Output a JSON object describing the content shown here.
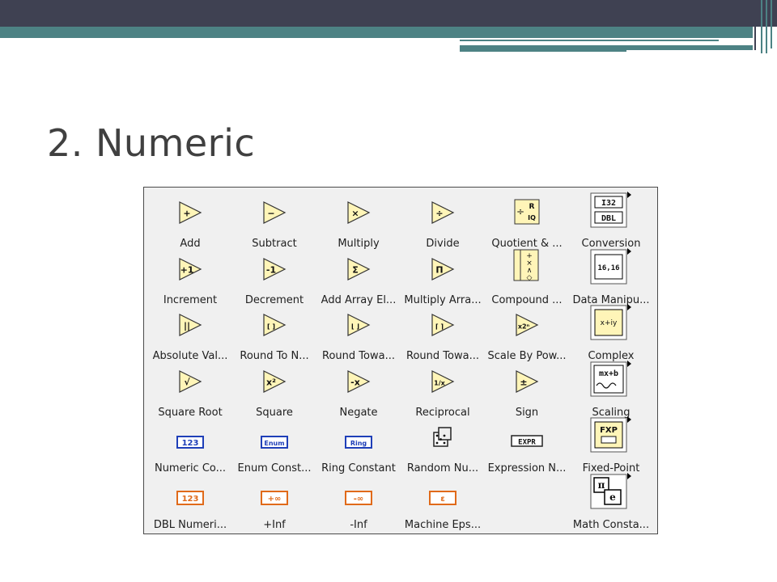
{
  "slide": {
    "title": "2. Numeric"
  },
  "palette": {
    "items": [
      {
        "label": "Add",
        "glyph": "+",
        "kind": "tri"
      },
      {
        "label": "Subtract",
        "glyph": "−",
        "kind": "tri"
      },
      {
        "label": "Multiply",
        "glyph": "×",
        "kind": "tri"
      },
      {
        "label": "Divide",
        "glyph": "÷",
        "kind": "tri"
      },
      {
        "label": "Quotient & ...",
        "glyph": "÷",
        "kind": "quotient"
      },
      {
        "label": "Conversion",
        "glyph": "I32 DBL",
        "kind": "conversion"
      },
      {
        "label": "Increment",
        "glyph": "+1",
        "kind": "tri"
      },
      {
        "label": "Decrement",
        "glyph": "-1",
        "kind": "tri"
      },
      {
        "label": "Add Array El...",
        "glyph": "Σ",
        "kind": "tri"
      },
      {
        "label": "Multiply Arra...",
        "glyph": "Π",
        "kind": "tri"
      },
      {
        "label": "Compound ...",
        "glyph": "+×",
        "kind": "compound"
      },
      {
        "label": "Data Manipu...",
        "glyph": "16 16",
        "kind": "datamanip"
      },
      {
        "label": "Absolute Val...",
        "glyph": "||",
        "kind": "tri"
      },
      {
        "label": "Round To N...",
        "glyph": "[ ]",
        "kind": "tri"
      },
      {
        "label": "Round Towa...",
        "glyph": "⌊ ⌋",
        "kind": "tri"
      },
      {
        "label": "Round Towa...",
        "glyph": "⌈ ⌉",
        "kind": "tri"
      },
      {
        "label": "Scale By Pow...",
        "glyph": "x2ⁿ",
        "kind": "tri"
      },
      {
        "label": "Complex",
        "glyph": "x+iy",
        "kind": "complex"
      },
      {
        "label": "Square Root",
        "glyph": "√",
        "kind": "tri"
      },
      {
        "label": "Square",
        "glyph": "x²",
        "kind": "tri"
      },
      {
        "label": "Negate",
        "glyph": "-x",
        "kind": "tri"
      },
      {
        "label": "Reciprocal",
        "glyph": "1/x",
        "kind": "tri"
      },
      {
        "label": "Sign",
        "glyph": "±",
        "kind": "tri"
      },
      {
        "label": "Scaling",
        "glyph": "mx+b",
        "kind": "scaling"
      },
      {
        "label": "Numeric Co...",
        "glyph": "123",
        "kind": "blueconst"
      },
      {
        "label": "Enum Const...",
        "glyph": "Enum",
        "kind": "blueconst"
      },
      {
        "label": "Ring Constant",
        "glyph": "Ring",
        "kind": "blueconst"
      },
      {
        "label": "Random Nu...",
        "glyph": "dice",
        "kind": "dice"
      },
      {
        "label": "Expression N...",
        "glyph": "EXPR",
        "kind": "expr"
      },
      {
        "label": "Fixed-Point",
        "glyph": "FXP",
        "kind": "fxp"
      },
      {
        "label": "DBL Numeri...",
        "glyph": "123",
        "kind": "orangeconst"
      },
      {
        "label": "+Inf",
        "glyph": "+∞",
        "kind": "orangeconst"
      },
      {
        "label": "-Inf",
        "glyph": "-∞",
        "kind": "orangeconst"
      },
      {
        "label": "Machine Eps...",
        "glyph": "ε",
        "kind": "orangeconst"
      },
      {
        "label": "",
        "glyph": "",
        "kind": "empty"
      },
      {
        "label": "Math Consta...",
        "glyph": "π e",
        "kind": "mathconst"
      }
    ]
  },
  "colors": {
    "topbar": "#3f4152",
    "accent": "#4d8284",
    "triangle_fill": "#fff5b8",
    "blue_const": "#1f3fb8",
    "orange_const": "#e06a1a"
  }
}
